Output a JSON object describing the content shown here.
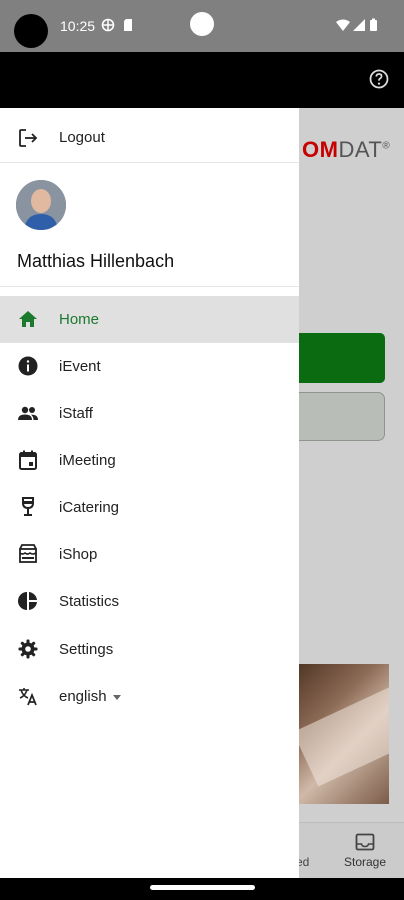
{
  "status_bar": {
    "time": "10:25"
  },
  "background": {
    "logo_red": "OM",
    "logo_gray": "DAT",
    "logo_mark": "®",
    "partial_nav_label": "ed",
    "storage_label": "Storage",
    "colors": {
      "primary_button": "#0a6b10"
    }
  },
  "drawer": {
    "logout_label": "Logout",
    "user_name": "Matthias Hillenbach",
    "items": [
      {
        "label": "Home",
        "icon": "home-icon",
        "active": true
      },
      {
        "label": "iEvent",
        "icon": "info-icon",
        "active": false
      },
      {
        "label": "iStaff",
        "icon": "people-icon",
        "active": false
      },
      {
        "label": "iMeeting",
        "icon": "calendar-icon",
        "active": false
      },
      {
        "label": "iCatering",
        "icon": "wine-glass-icon",
        "active": false
      },
      {
        "label": "iShop",
        "icon": "shop-icon",
        "active": false
      },
      {
        "label": "Statistics",
        "icon": "pie-chart-icon",
        "active": false
      },
      {
        "label": "Settings",
        "icon": "gear-icon",
        "active": false
      }
    ],
    "language": {
      "label": "english",
      "icon": "translate-icon"
    },
    "colors": {
      "active_text": "#1b7a2e",
      "active_bg": "#e0e0e0"
    }
  }
}
